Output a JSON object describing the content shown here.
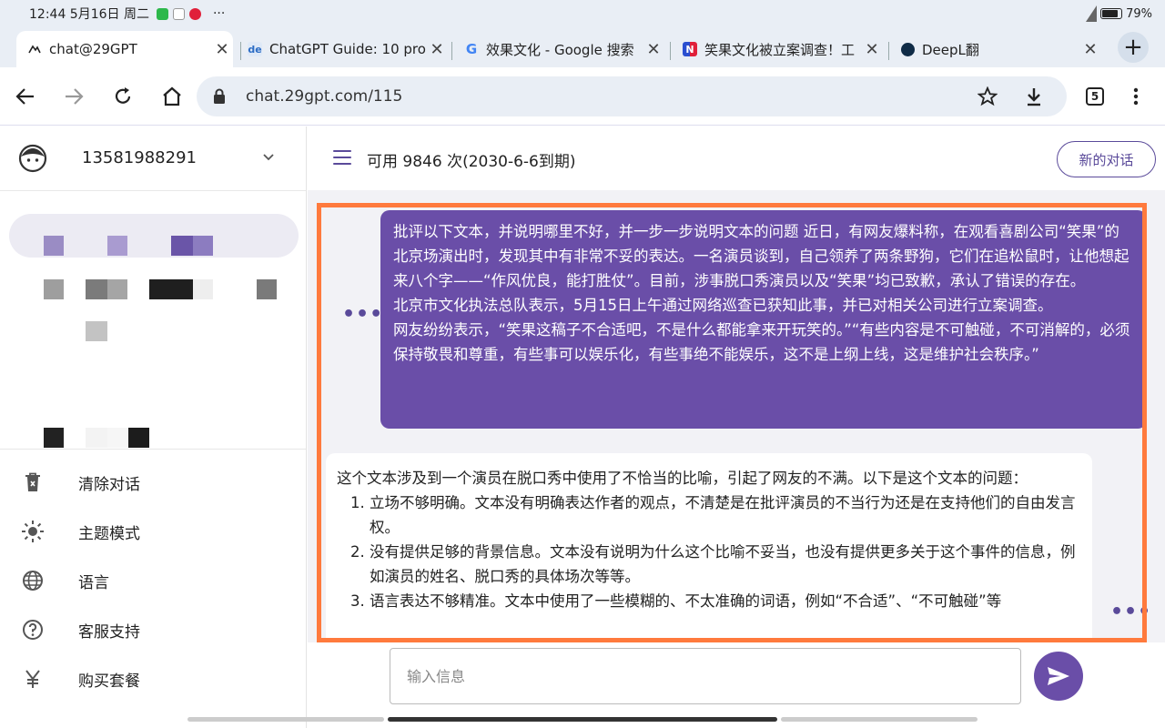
{
  "status_bar": {
    "time": "12:44 5月16日 周二",
    "more": "···",
    "battery": "79%"
  },
  "tabs": [
    {
      "title": "chat@29GPT",
      "fav": "chat-logo"
    },
    {
      "title": "ChatGPT Guide: 10 pro",
      "fav": "de"
    },
    {
      "title": "效果文化 - Google 搜索",
      "fav": "G"
    },
    {
      "title": "笑果文化被立案调查！工",
      "fav": "N"
    },
    {
      "title": "DeepL翻",
      "fav": "deepl"
    }
  ],
  "url": "chat.29gpt.com/115",
  "tab_count": "5",
  "user": {
    "phone": "13581988291"
  },
  "sidebar_menu": [
    {
      "label": "清除对话",
      "icon": "trash-icon"
    },
    {
      "label": "主题模式",
      "icon": "sun-icon"
    },
    {
      "label": "语言",
      "icon": "globe-icon"
    },
    {
      "label": "客服支持",
      "icon": "help-icon"
    },
    {
      "label": "购买套餐",
      "icon": "yen-icon"
    }
  ],
  "header": {
    "quota": "可用 9846 次(2030-6-6到期)",
    "new_chat": "新的对话"
  },
  "user_message": [
    "批评以下文本，并说明哪里不好，并一步一步说明文本的问题 近日，有网友爆料称，在观看喜剧公司“笑果”的北京场演出时，发现其中有非常不妥的表达。一名演员谈到，自己领养了两条野狗，它们在追松鼠时，让他想起来八个字——“作风优良，能打胜仗”。目前，涉事脱口秀演员以及“笑果”均已致歉，承认了错误的存在。",
    "北京市文化执法总队表示，5月15日上午通过网络巡查已获知此事，并已对相关公司进行立案调查。",
    "网友纷纷表示，“笑果这稿子不合适吧，不是什么都能拿来开玩笑的。”“有些内容是不可触碰，不可消解的，必须保持敬畏和尊重，有些事可以娱乐化，有些事绝不能娱乐，这不是上纲上线，这是维护社会秩序。”"
  ],
  "bot_message": {
    "intro": "这个文本涉及到一个演员在脱口秀中使用了不恰当的比喻，引起了网友的不满。以下是这个文本的问题：",
    "points": [
      "立场不够明确。文本没有明确表达作者的观点，不清楚是在批评演员的不当行为还是在支持他们的自由发言权。",
      "没有提供足够的背景信息。文本没有说明为什么这个比喻不妥当，也没有提供更多关于这个事件的信息，例如演员的姓名、脱口秀的具体场次等等。",
      "语言表达不够精准。文本中使用了一些模糊的、不太准确的词语，例如“不合适”、“不可触碰”等"
    ]
  },
  "input": {
    "placeholder": "输入信息"
  },
  "colors": {
    "accent": "#6a4ea8",
    "highlight": "#ff7a3d"
  }
}
